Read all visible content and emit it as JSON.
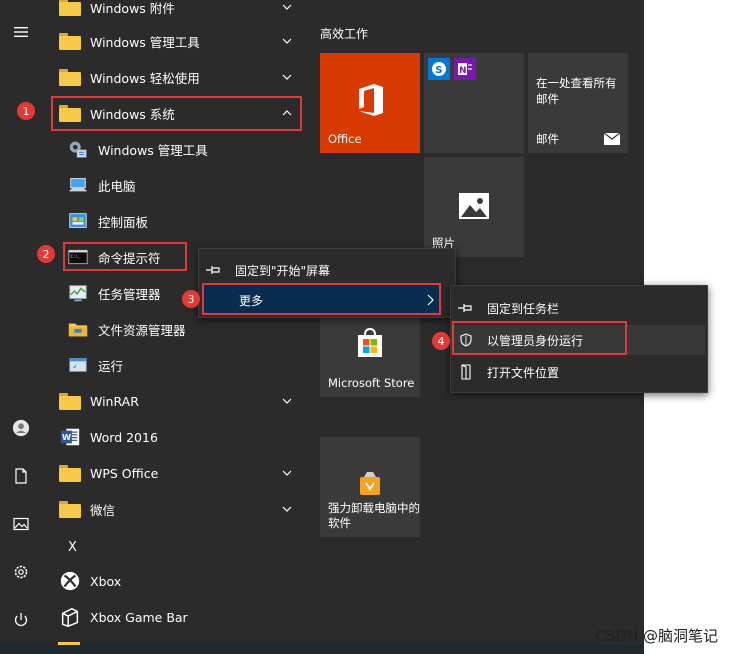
{
  "rail": {
    "icons": [
      "hamburger-icon",
      "user-icon",
      "document-icon",
      "pictures-icon",
      "settings-icon",
      "power-icon"
    ]
  },
  "apps": [
    {
      "label": "Windows 附件",
      "icon": "folder",
      "expand": "down"
    },
    {
      "label": "Windows 管理工具",
      "icon": "folder",
      "expand": "down"
    },
    {
      "label": "Windows 轻松使用",
      "icon": "folder",
      "expand": "down"
    },
    {
      "label": "Windows 系统",
      "icon": "folder",
      "expand": "up"
    },
    {
      "label": "Windows 管理工具",
      "icon": "admin-tools"
    },
    {
      "label": "此电脑",
      "icon": "this-pc"
    },
    {
      "label": "控制面板",
      "icon": "control-panel"
    },
    {
      "label": "命令提示符",
      "icon": "cmd"
    },
    {
      "label": "任务管理器",
      "icon": "task-manager"
    },
    {
      "label": "文件资源管理器",
      "icon": "file-explorer"
    },
    {
      "label": "运行",
      "icon": "run"
    },
    {
      "label": "WinRAR",
      "icon": "folder",
      "expand": "down"
    },
    {
      "label": "Word 2016",
      "icon": "word"
    },
    {
      "label": "WPS Office",
      "icon": "folder",
      "expand": "down"
    },
    {
      "label": "微信",
      "icon": "folder",
      "expand": "down"
    },
    {
      "label": "X",
      "icon": "letter"
    },
    {
      "label": "Xbox",
      "icon": "xbox"
    },
    {
      "label": "Xbox Game Bar",
      "icon": "xbox-game-bar"
    }
  ],
  "tiles": {
    "group_title": "高效工作",
    "office": {
      "label": "Office",
      "color": "#d83b01"
    },
    "mail": {
      "text": "在一处查看所有邮件",
      "label": "邮件"
    },
    "photos": {
      "label": "照片"
    },
    "store": {
      "label": "Microsoft Store"
    },
    "uninstaller": {
      "label": "强力卸载电脑中的软件"
    }
  },
  "context_menu": {
    "items": [
      {
        "label": "固定到\"开始\"屏幕",
        "icon": "pin-icon"
      },
      {
        "label": "更多",
        "icon": "",
        "highlight": "#0a2d4f"
      }
    ]
  },
  "submenu": {
    "items": [
      {
        "label": "固定到任务栏",
        "icon": "pin-icon"
      },
      {
        "label": "以管理员身份运行",
        "icon": "shield-icon"
      },
      {
        "label": "打开文件位置",
        "icon": "open-folder-icon"
      }
    ]
  },
  "annotations": [
    "1",
    "2",
    "3",
    "4"
  ],
  "watermark": "CSDN @脑洞笔记",
  "colors": {
    "background": "#2b2b2b",
    "annotation": "#e03a3a",
    "office": "#d83b01"
  }
}
